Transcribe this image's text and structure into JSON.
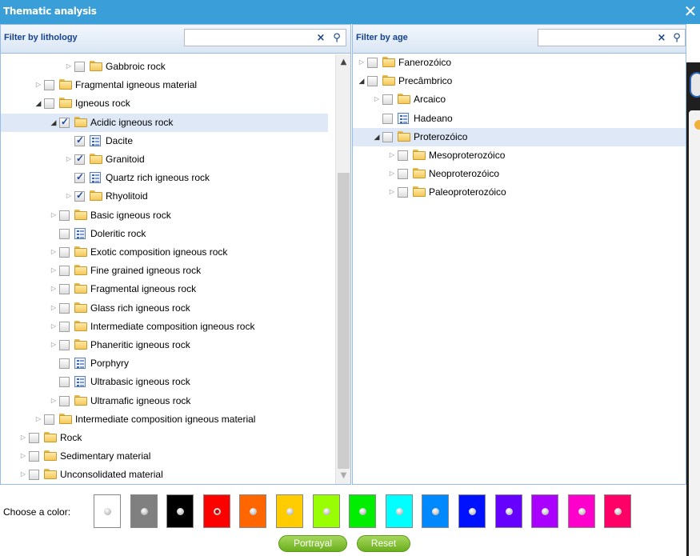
{
  "window": {
    "title": "Thematic analysis",
    "close_glyph": "✕"
  },
  "lithology": {
    "header": "Filter by lithology",
    "search_value": "",
    "clear_glyph": "×",
    "search_glyph": "⚲",
    "nodes": [
      {
        "label": "Gabbroic rock",
        "level": 4,
        "type": "folder",
        "expander": "closed",
        "checked": false,
        "selected": false
      },
      {
        "label": "Fragmental igneous material",
        "level": 2,
        "type": "folder",
        "expander": "closed",
        "checked": false,
        "selected": false
      },
      {
        "label": "Igneous rock",
        "level": 2,
        "type": "folder",
        "expander": "open",
        "checked": false,
        "selected": false
      },
      {
        "label": "Acidic igneous rock",
        "level": 3,
        "type": "folder",
        "expander": "open",
        "checked": true,
        "selected": true
      },
      {
        "label": "Dacite",
        "level": 4,
        "type": "leaf",
        "expander": "none",
        "checked": true,
        "selected": false
      },
      {
        "label": "Granitoid",
        "level": 4,
        "type": "folder",
        "expander": "closed",
        "checked": true,
        "selected": false
      },
      {
        "label": "Quartz rich igneous rock",
        "level": 4,
        "type": "leaf",
        "expander": "none",
        "checked": true,
        "selected": false
      },
      {
        "label": "Rhyolitoid",
        "level": 4,
        "type": "folder",
        "expander": "closed",
        "checked": true,
        "selected": false
      },
      {
        "label": "Basic igneous rock",
        "level": 3,
        "type": "folder",
        "expander": "closed",
        "checked": false,
        "selected": false
      },
      {
        "label": "Doleritic rock",
        "level": 3,
        "type": "leaf",
        "expander": "none",
        "checked": false,
        "selected": false
      },
      {
        "label": "Exotic composition igneous rock",
        "level": 3,
        "type": "folder",
        "expander": "closed",
        "checked": false,
        "selected": false
      },
      {
        "label": "Fine grained igneous rock",
        "level": 3,
        "type": "folder",
        "expander": "closed",
        "checked": false,
        "selected": false
      },
      {
        "label": "Fragmental igneous rock",
        "level": 3,
        "type": "folder",
        "expander": "closed",
        "checked": false,
        "selected": false
      },
      {
        "label": "Glass rich igneous rock",
        "level": 3,
        "type": "folder",
        "expander": "closed",
        "checked": false,
        "selected": false
      },
      {
        "label": "Intermediate composition igneous rock",
        "level": 3,
        "type": "folder",
        "expander": "closed",
        "checked": false,
        "selected": false
      },
      {
        "label": "Phaneritic igneous rock",
        "level": 3,
        "type": "folder",
        "expander": "closed",
        "checked": false,
        "selected": false
      },
      {
        "label": "Porphyry",
        "level": 3,
        "type": "leaf",
        "expander": "none",
        "checked": false,
        "selected": false
      },
      {
        "label": "Ultrabasic igneous rock",
        "level": 3,
        "type": "leaf",
        "expander": "none",
        "checked": false,
        "selected": false
      },
      {
        "label": "Ultramafic igneous rock",
        "level": 3,
        "type": "folder",
        "expander": "closed",
        "checked": false,
        "selected": false
      },
      {
        "label": "Intermediate composition igneous material",
        "level": 2,
        "type": "folder",
        "expander": "closed",
        "checked": false,
        "selected": false
      },
      {
        "label": "Rock",
        "level": 1,
        "type": "folder",
        "expander": "closed",
        "checked": false,
        "selected": false
      },
      {
        "label": "Sedimentary material",
        "level": 1,
        "type": "folder",
        "expander": "closed",
        "checked": false,
        "selected": false
      },
      {
        "label": "Unconsolidated material",
        "level": 1,
        "type": "folder",
        "expander": "closed",
        "checked": false,
        "selected": false
      }
    ]
  },
  "age": {
    "header": "Filter by age",
    "search_value": "",
    "clear_glyph": "×",
    "search_glyph": "⚲",
    "nodes": [
      {
        "label": "Fanerozóico",
        "level": 1,
        "type": "folder",
        "expander": "closed",
        "checked": false,
        "selected": false
      },
      {
        "label": "Precâmbrico",
        "level": 1,
        "type": "folder",
        "expander": "open",
        "checked": false,
        "selected": false
      },
      {
        "label": "Arcaico",
        "level": 2,
        "type": "folder",
        "expander": "closed",
        "checked": false,
        "selected": false
      },
      {
        "label": "Hadeano",
        "level": 2,
        "type": "leaf",
        "expander": "none",
        "checked": false,
        "selected": false
      },
      {
        "label": "Proterozóico",
        "level": 2,
        "type": "folder",
        "expander": "open",
        "checked": false,
        "selected": true
      },
      {
        "label": "Mesoproterozóico",
        "level": 3,
        "type": "folder",
        "expander": "closed",
        "checked": false,
        "selected": false
      },
      {
        "label": "Neoproterozóico",
        "level": 3,
        "type": "folder",
        "expander": "closed",
        "checked": false,
        "selected": false
      },
      {
        "label": "Paleoproterozóico",
        "level": 3,
        "type": "folder",
        "expander": "closed",
        "checked": false,
        "selected": false
      }
    ]
  },
  "color_picker": {
    "label": "Choose a color:",
    "selected_index": 3,
    "colors": [
      "#ffffff",
      "#808080",
      "#000000",
      "#ff0000",
      "#ff6600",
      "#ffcc00",
      "#99ff00",
      "#00ee00",
      "#00ffff",
      "#0088ff",
      "#0011ff",
      "#6600ff",
      "#aa00ff",
      "#ff00cc",
      "#ff0066"
    ]
  },
  "buttons": {
    "portrayal": "Portrayal",
    "reset": "Reset"
  },
  "icons": {
    "expand_closed": "▷",
    "expand_open": "◢",
    "scroll_up": "▲",
    "scroll_down": "▼"
  }
}
